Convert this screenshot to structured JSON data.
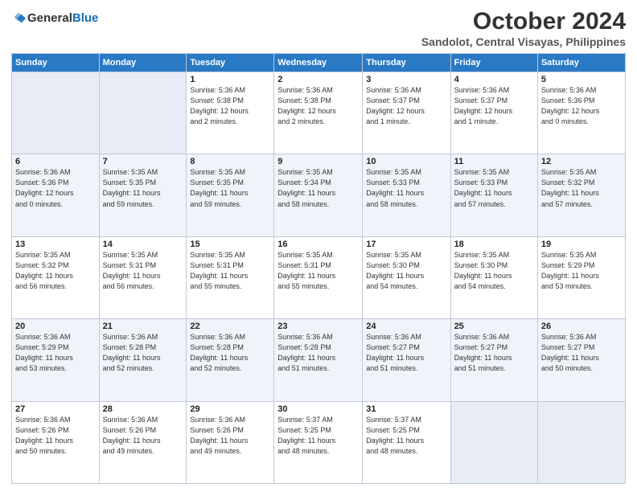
{
  "logo": {
    "line1": "General",
    "line2": "Blue"
  },
  "title": "October 2024",
  "subtitle": "Sandolot, Central Visayas, Philippines",
  "headers": [
    "Sunday",
    "Monday",
    "Tuesday",
    "Wednesday",
    "Thursday",
    "Friday",
    "Saturday"
  ],
  "weeks": [
    [
      {
        "day": "",
        "detail": ""
      },
      {
        "day": "",
        "detail": ""
      },
      {
        "day": "1",
        "detail": "Sunrise: 5:36 AM\nSunset: 5:38 PM\nDaylight: 12 hours\nand 2 minutes."
      },
      {
        "day": "2",
        "detail": "Sunrise: 5:36 AM\nSunset: 5:38 PM\nDaylight: 12 hours\nand 2 minutes."
      },
      {
        "day": "3",
        "detail": "Sunrise: 5:36 AM\nSunset: 5:37 PM\nDaylight: 12 hours\nand 1 minute."
      },
      {
        "day": "4",
        "detail": "Sunrise: 5:36 AM\nSunset: 5:37 PM\nDaylight: 12 hours\nand 1 minute."
      },
      {
        "day": "5",
        "detail": "Sunrise: 5:36 AM\nSunset: 5:36 PM\nDaylight: 12 hours\nand 0 minutes."
      }
    ],
    [
      {
        "day": "6",
        "detail": "Sunrise: 5:36 AM\nSunset: 5:36 PM\nDaylight: 12 hours\nand 0 minutes."
      },
      {
        "day": "7",
        "detail": "Sunrise: 5:35 AM\nSunset: 5:35 PM\nDaylight: 11 hours\nand 59 minutes."
      },
      {
        "day": "8",
        "detail": "Sunrise: 5:35 AM\nSunset: 5:35 PM\nDaylight: 11 hours\nand 59 minutes."
      },
      {
        "day": "9",
        "detail": "Sunrise: 5:35 AM\nSunset: 5:34 PM\nDaylight: 11 hours\nand 58 minutes."
      },
      {
        "day": "10",
        "detail": "Sunrise: 5:35 AM\nSunset: 5:33 PM\nDaylight: 11 hours\nand 58 minutes."
      },
      {
        "day": "11",
        "detail": "Sunrise: 5:35 AM\nSunset: 5:33 PM\nDaylight: 11 hours\nand 57 minutes."
      },
      {
        "day": "12",
        "detail": "Sunrise: 5:35 AM\nSunset: 5:32 PM\nDaylight: 11 hours\nand 57 minutes."
      }
    ],
    [
      {
        "day": "13",
        "detail": "Sunrise: 5:35 AM\nSunset: 5:32 PM\nDaylight: 11 hours\nand 56 minutes."
      },
      {
        "day": "14",
        "detail": "Sunrise: 5:35 AM\nSunset: 5:31 PM\nDaylight: 11 hours\nand 56 minutes."
      },
      {
        "day": "15",
        "detail": "Sunrise: 5:35 AM\nSunset: 5:31 PM\nDaylight: 11 hours\nand 55 minutes."
      },
      {
        "day": "16",
        "detail": "Sunrise: 5:35 AM\nSunset: 5:31 PM\nDaylight: 11 hours\nand 55 minutes."
      },
      {
        "day": "17",
        "detail": "Sunrise: 5:35 AM\nSunset: 5:30 PM\nDaylight: 11 hours\nand 54 minutes."
      },
      {
        "day": "18",
        "detail": "Sunrise: 5:35 AM\nSunset: 5:30 PM\nDaylight: 11 hours\nand 54 minutes."
      },
      {
        "day": "19",
        "detail": "Sunrise: 5:35 AM\nSunset: 5:29 PM\nDaylight: 11 hours\nand 53 minutes."
      }
    ],
    [
      {
        "day": "20",
        "detail": "Sunrise: 5:36 AM\nSunset: 5:29 PM\nDaylight: 11 hours\nand 53 minutes."
      },
      {
        "day": "21",
        "detail": "Sunrise: 5:36 AM\nSunset: 5:28 PM\nDaylight: 11 hours\nand 52 minutes."
      },
      {
        "day": "22",
        "detail": "Sunrise: 5:36 AM\nSunset: 5:28 PM\nDaylight: 11 hours\nand 52 minutes."
      },
      {
        "day": "23",
        "detail": "Sunrise: 5:36 AM\nSunset: 5:28 PM\nDaylight: 11 hours\nand 51 minutes."
      },
      {
        "day": "24",
        "detail": "Sunrise: 5:36 AM\nSunset: 5:27 PM\nDaylight: 11 hours\nand 51 minutes."
      },
      {
        "day": "25",
        "detail": "Sunrise: 5:36 AM\nSunset: 5:27 PM\nDaylight: 11 hours\nand 51 minutes."
      },
      {
        "day": "26",
        "detail": "Sunrise: 5:36 AM\nSunset: 5:27 PM\nDaylight: 11 hours\nand 50 minutes."
      }
    ],
    [
      {
        "day": "27",
        "detail": "Sunrise: 5:36 AM\nSunset: 5:26 PM\nDaylight: 11 hours\nand 50 minutes."
      },
      {
        "day": "28",
        "detail": "Sunrise: 5:36 AM\nSunset: 5:26 PM\nDaylight: 11 hours\nand 49 minutes."
      },
      {
        "day": "29",
        "detail": "Sunrise: 5:36 AM\nSunset: 5:26 PM\nDaylight: 11 hours\nand 49 minutes."
      },
      {
        "day": "30",
        "detail": "Sunrise: 5:37 AM\nSunset: 5:25 PM\nDaylight: 11 hours\nand 48 minutes."
      },
      {
        "day": "31",
        "detail": "Sunrise: 5:37 AM\nSunset: 5:25 PM\nDaylight: 11 hours\nand 48 minutes."
      },
      {
        "day": "",
        "detail": ""
      },
      {
        "day": "",
        "detail": ""
      }
    ]
  ]
}
